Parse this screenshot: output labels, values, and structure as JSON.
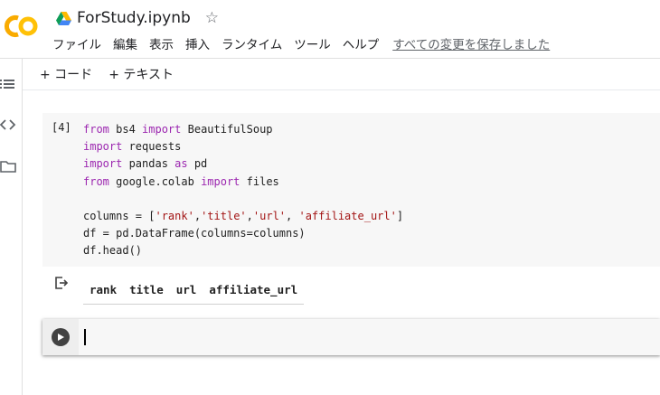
{
  "header": {
    "doc_title": "ForStudy.ipynb",
    "star": "☆"
  },
  "menu": {
    "items": [
      "ファイル",
      "編集",
      "表示",
      "挿入",
      "ランタイム",
      "ツール",
      "ヘルプ"
    ],
    "saved_status": "すべての変更を保存しました"
  },
  "toolbar": {
    "add_code": "+ コード",
    "add_text": "+ テキスト"
  },
  "cell": {
    "execution_count": "[4]"
  },
  "output": {
    "columns": [
      "rank",
      "title",
      "url",
      "affiliate_url"
    ]
  },
  "colors": {
    "keyword": "#9c27b0",
    "string": "#a31515",
    "logo_orange": "#f9ab00",
    "logo_yellow": "#ffc107"
  }
}
